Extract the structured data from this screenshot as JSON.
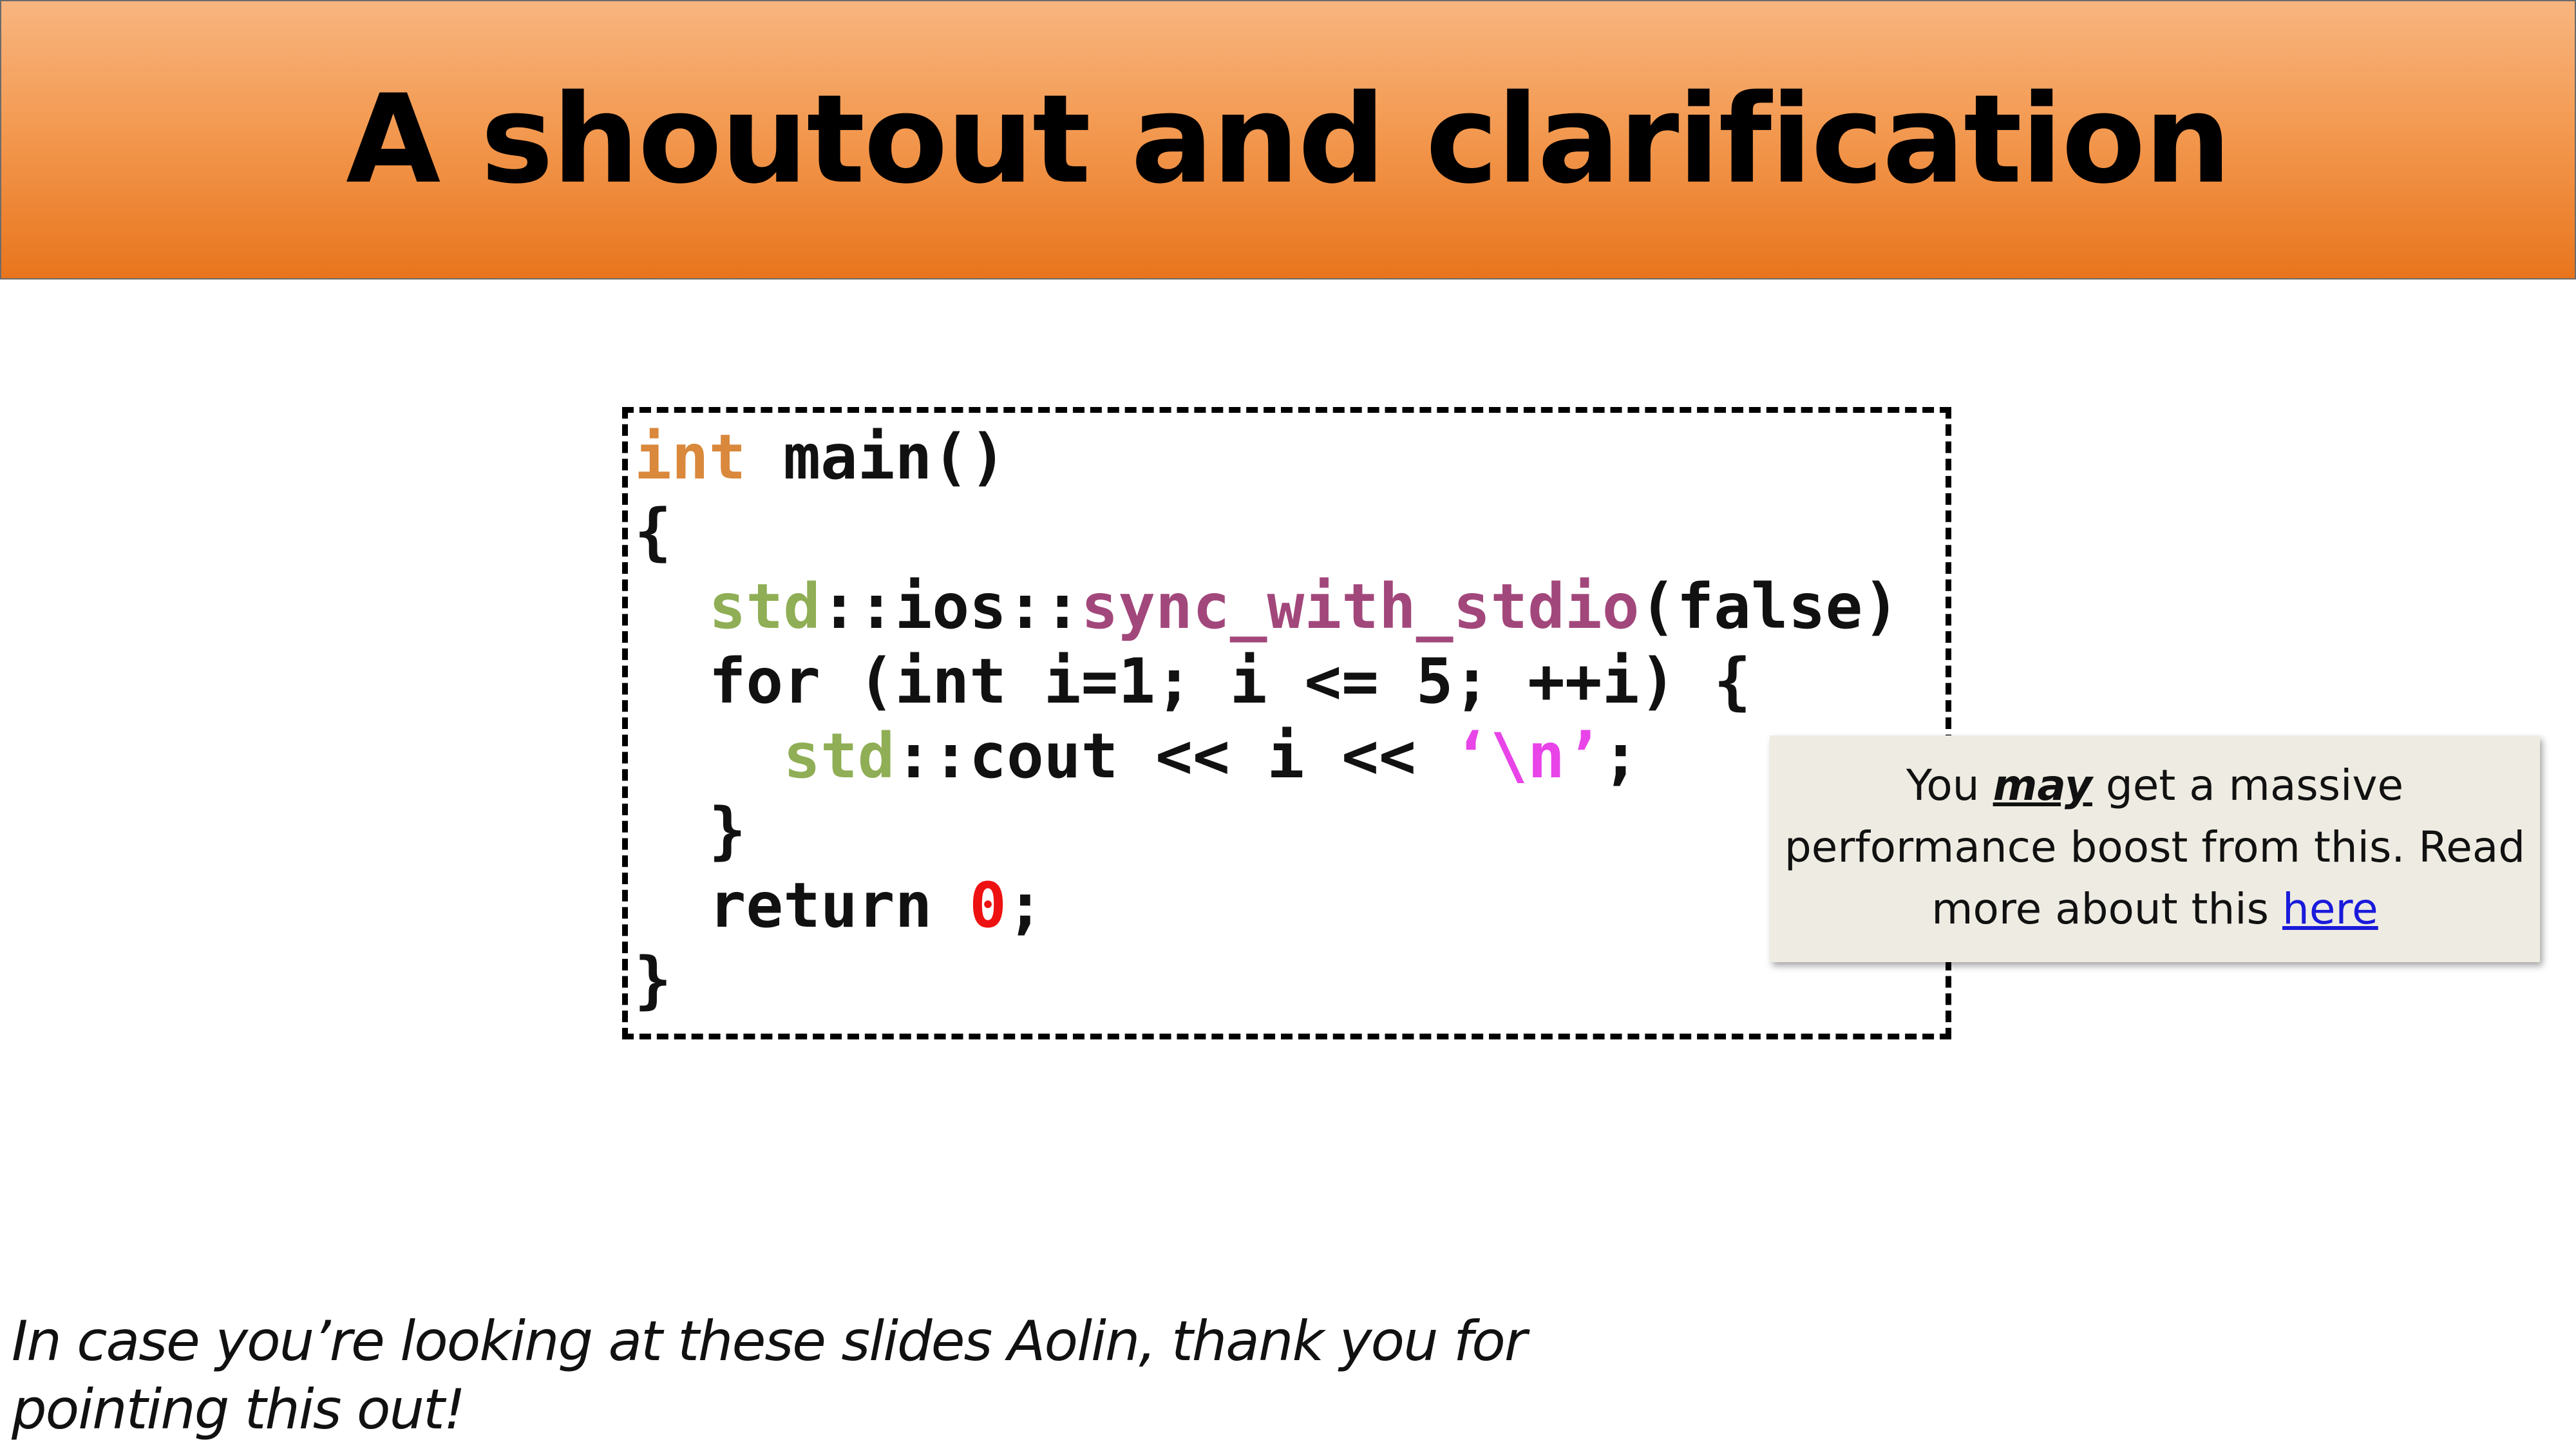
{
  "slide": {
    "title": "A shoutout and clarification"
  },
  "code": {
    "lines": [
      [
        {
          "t": "int",
          "c": "kw"
        },
        {
          "t": " main()",
          "c": "plain"
        }
      ],
      [
        {
          "t": "{",
          "c": "plain"
        }
      ],
      [
        {
          "t": "  ",
          "c": "plain"
        },
        {
          "t": "std",
          "c": "ns"
        },
        {
          "t": "::ios::",
          "c": "plain"
        },
        {
          "t": "sync_with_stdio",
          "c": "fn"
        },
        {
          "t": "(false)",
          "c": "plain"
        }
      ],
      [
        {
          "t": "  for (int i=1; i <= 5; ++i) {",
          "c": "plain"
        }
      ],
      [
        {
          "t": "    ",
          "c": "plain"
        },
        {
          "t": "std",
          "c": "ns"
        },
        {
          "t": "::cout << i << ",
          "c": "plain"
        },
        {
          "t": "‘\\n’",
          "c": "str"
        },
        {
          "t": ";",
          "c": "plain"
        }
      ],
      [
        {
          "t": "  }",
          "c": "plain"
        }
      ],
      [
        {
          "t": "  return ",
          "c": "plain"
        },
        {
          "t": "0",
          "c": "num"
        },
        {
          "t": ";",
          "c": "plain"
        }
      ],
      [
        {
          "t": "}",
          "c": "plain"
        }
      ]
    ]
  },
  "tooltip": {
    "prefix": "You ",
    "emphasis": "may",
    "middle": " get a massive performance boost from this. Read more about this ",
    "link_text": "here"
  },
  "footnote": {
    "text": "In case you’re looking at these slides Aolin, thank you for pointing this out!"
  },
  "colors": {
    "keyword": "#d9883c",
    "namespace": "#8fae55",
    "function": "#a2477b",
    "string": "#e844e8",
    "number": "#ee1111",
    "header_gradient_top": "#f8b57f",
    "header_gradient_bottom": "#e8751d"
  }
}
